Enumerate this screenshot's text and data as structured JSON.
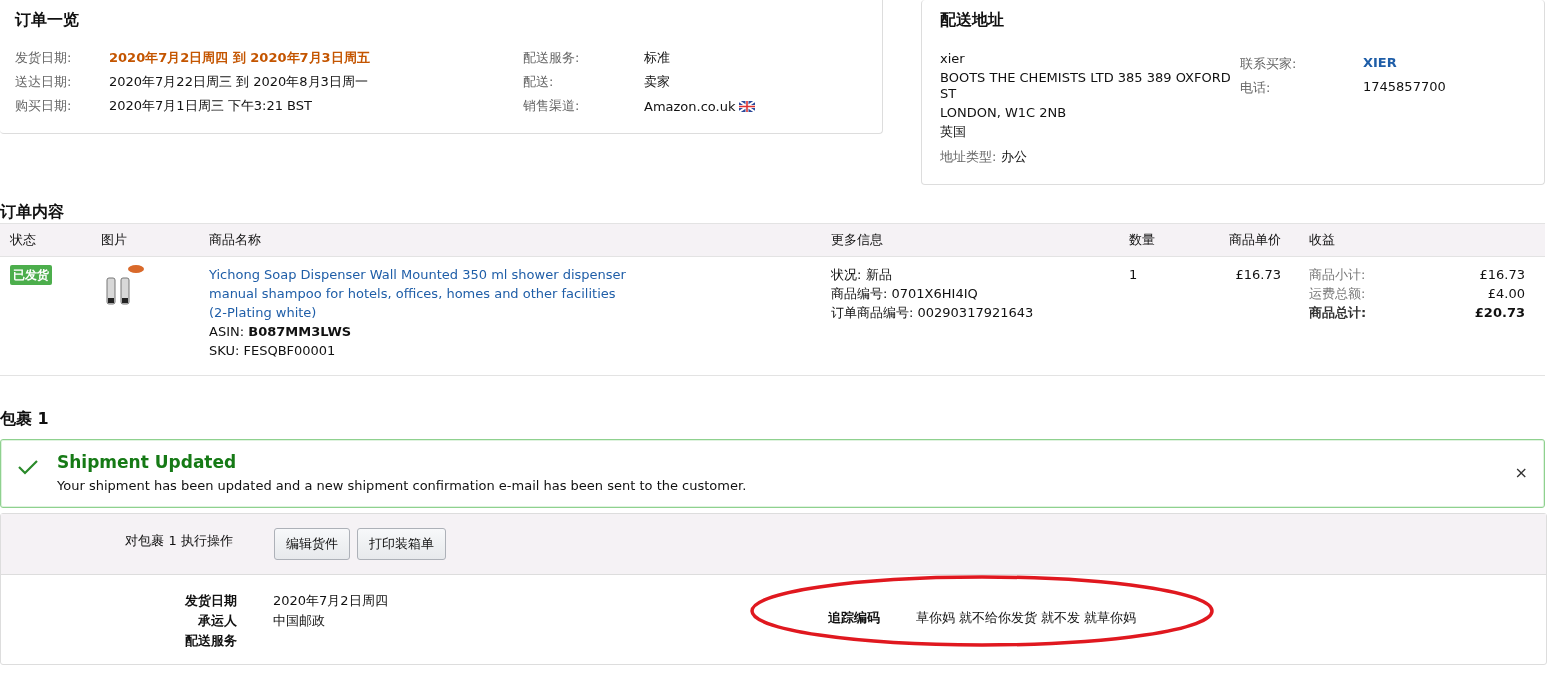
{
  "order_summary": {
    "title": "订单一览",
    "left": [
      {
        "label": "发货日期:",
        "value": "2020年7月2日周四 到 2020年7月3日周五",
        "emphasis": true
      },
      {
        "label": "送达日期:",
        "value": "2020年7月22日周三 到 2020年8月3日周一",
        "emphasis": false
      },
      {
        "label": "购买日期:",
        "value": "2020年7月1日周三 下午3:21 BST",
        "emphasis": false
      }
    ],
    "right": [
      {
        "label": "配送服务:",
        "value": "标准",
        "kind": "text"
      },
      {
        "label": "配送:",
        "value": "卖家",
        "kind": "text"
      },
      {
        "label": "销售渠道:",
        "value": "Amazon.co.uk",
        "kind": "marketplace"
      }
    ]
  },
  "shipping_address": {
    "title": "配送地址",
    "lines": [
      "xier",
      "BOOTS THE CHEMISTS LTD 385 389 OXFORD ST",
      "LONDON, W1C 2NB",
      "英国"
    ],
    "address_type": {
      "label": "地址类型:",
      "value": "办公"
    },
    "contacts": [
      {
        "label": "联系买家:",
        "value": "XIER",
        "kind": "link"
      },
      {
        "label": "电话:",
        "value": "1745857700",
        "kind": "text"
      }
    ]
  },
  "order_contents": {
    "title": "订单内容",
    "columns": [
      "状态",
      "图片",
      "商品名称",
      "更多信息",
      "数量",
      "商品单价",
      "收益"
    ],
    "rows": [
      {
        "status": "已发货",
        "image": {
          "kind": "picture"
        },
        "product": {
          "title": "Yichong Soap Dispenser Wall Mounted 350 ml shower dispenser manual shampoo for hotels, offices, homes and other facilities (2-Plating white)",
          "asin_label": "ASIN:",
          "asin": "B087MM3LWS",
          "sku": "SKU: FESQBF00001"
        },
        "more_info": [
          "状况: 新品",
          "商品编号: 0701X6HI4IQ",
          "订单商品编号: 00290317921643"
        ],
        "quantity": "1",
        "unit_price": "£16.73",
        "proceeds": [
          {
            "label": "商品小计:",
            "value": "£16.73",
            "total": false
          },
          {
            "label": "运费总额:",
            "value": "£4.00",
            "total": false
          },
          {
            "label": "商品总计:",
            "value": "£20.73",
            "total": true
          }
        ]
      }
    ]
  },
  "package": {
    "title": "包裹 1",
    "alert": {
      "title": "Shipment Updated",
      "message": "Your shipment has been updated and a new shipment confirmation e-mail has been sent to the customer.",
      "close": "×"
    },
    "actions": {
      "label": "对包裹 1 执行操作",
      "buttons": [
        "编辑货件",
        "打印装箱单"
      ]
    },
    "details": [
      {
        "label": "发货日期",
        "value": "2020年7月2日周四"
      },
      {
        "label": "承运人",
        "value": "中国邮政"
      },
      {
        "label": "配送服务"
      }
    ],
    "tracking": {
      "label": "追踪编码",
      "value": "草你妈 就不给你发货 就不发 就草你妈",
      "circled": true
    }
  }
}
